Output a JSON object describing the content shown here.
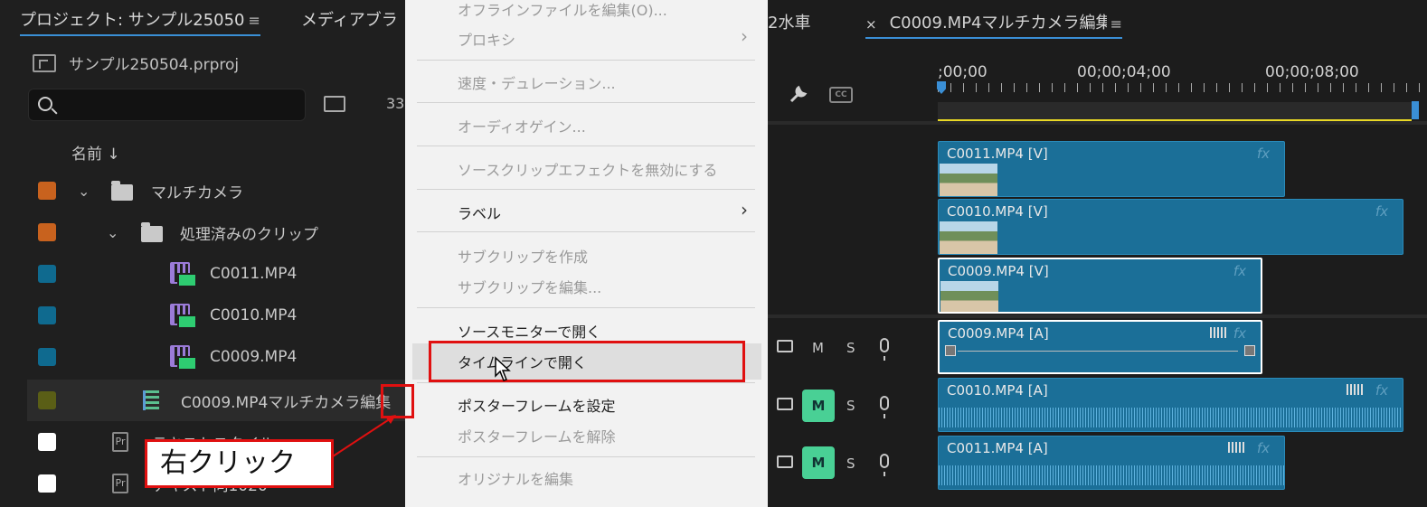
{
  "project_panel": {
    "tabs": [
      {
        "label": "プロジェクト: サンプル25050",
        "active": true
      },
      {
        "label": "メディアブラ",
        "active": false
      }
    ],
    "menu_icon": "hamburger-icon",
    "project_file": "サンプル250504.prproj",
    "search_placeholder": "",
    "item_count": "33",
    "column_header": "名前 ↓",
    "items": [
      {
        "label": "マルチカメラ",
        "type": "folder",
        "color": "#c8621e",
        "expanded": true
      },
      {
        "label": "処理済みのクリップ",
        "type": "folder",
        "color": "#c8621e",
        "expanded": true
      },
      {
        "label": "C0011.MP4",
        "type": "clip",
        "color": "#0f6a8f"
      },
      {
        "label": "C0010.MP4",
        "type": "clip",
        "color": "#0f6a8f"
      },
      {
        "label": "C0009.MP4",
        "type": "clip",
        "color": "#0f6a8f"
      },
      {
        "label": "C0009.MP4マルチカメラ編集",
        "type": "sequence",
        "color": "#5a5e16",
        "selected": true
      },
      {
        "label": "テキストスタイル",
        "type": "pr",
        "color": "#ffffff"
      },
      {
        "label": "テキスト同1020",
        "type": "pr",
        "color": "#ffffff"
      }
    ]
  },
  "context_menu": {
    "items": [
      {
        "label": "オフラインファイルを編集(O)...",
        "disabled": true
      },
      {
        "label": "プロキシ",
        "disabled": true,
        "submenu": true
      },
      {
        "label": "速度・デュレーション...",
        "disabled": true
      },
      {
        "label": "オーディオゲイン...",
        "disabled": true
      },
      {
        "label": "ソースクリップエフェクトを無効にする",
        "disabled": true
      },
      {
        "label": "ラベル",
        "disabled": false,
        "submenu": true
      },
      {
        "label": "サブクリップを作成",
        "disabled": true
      },
      {
        "label": "サブクリップを編集...",
        "disabled": true
      },
      {
        "label": "ソースモニターで開く",
        "disabled": false
      },
      {
        "label": "タイムラインで開く",
        "disabled": false,
        "hovered": true
      },
      {
        "label": "ポスターフレームを設定",
        "disabled": false
      },
      {
        "label": "ポスターフレームを解除",
        "disabled": true
      },
      {
        "label": "オリジナルを編集",
        "disabled": true
      }
    ]
  },
  "timeline": {
    "tabs": [
      {
        "label": "2水車",
        "active": false
      },
      {
        "label": "C0009.MP4マルチカメラ編集",
        "active": true,
        "closable": true
      }
    ],
    "close_icon": "×",
    "timecodes": [
      ";00;00",
      "00;00;04;00",
      "00;00;08;00"
    ],
    "tools": [
      "wrench-icon",
      "cc-icon"
    ],
    "video_clips": [
      {
        "label": "C0011.MP4 [V]"
      },
      {
        "label": "C0010.MP4 [V]"
      },
      {
        "label": "C0009.MP4 [V]",
        "selected": true
      }
    ],
    "audio_clips": [
      {
        "label": "C0009.MP4 [A]",
        "selected": true
      },
      {
        "label": "C0010.MP4 [A]"
      },
      {
        "label": "C0011.MP4 [A]"
      }
    ],
    "fx_label": "fx",
    "audio_tracks": [
      {
        "mute": "M",
        "solo": "S",
        "muted": false
      },
      {
        "mute": "M",
        "solo": "S",
        "muted": true
      },
      {
        "mute": "M",
        "solo": "S",
        "muted": true
      }
    ]
  },
  "annotation": {
    "callout_text": "右クリック",
    "highlight_color": "#e01010"
  }
}
